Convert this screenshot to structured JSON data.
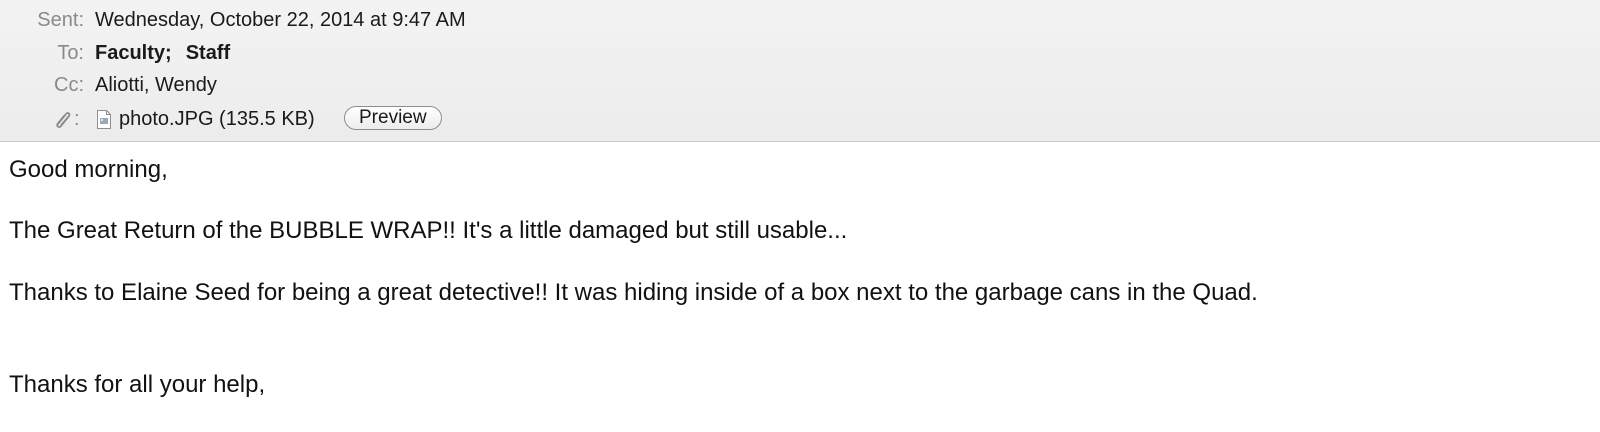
{
  "header": {
    "sent_label": "Sent:",
    "sent_value": "Wednesday, October 22, 2014 at 9:47 AM",
    "to_label": "To:",
    "to_recipients": [
      "Faculty;",
      "Staff"
    ],
    "cc_label": "Cc:",
    "cc_value": "Aliotti, Wendy",
    "attachment_colon": ":",
    "attachment_icon": "paperclip-icon",
    "attachment_name": "photo.JPG (135.5 KB)",
    "preview_label": "Preview"
  },
  "body": {
    "greeting": "Good morning,",
    "line1": "The Great Return of the BUBBLE WRAP!!  It's a little damaged but still usable...",
    "line2": "Thanks to Elaine Seed for being a great detective!!   It was hiding inside of a box next to the garbage cans in the Quad.",
    "closing": "Thanks for all your help,"
  }
}
